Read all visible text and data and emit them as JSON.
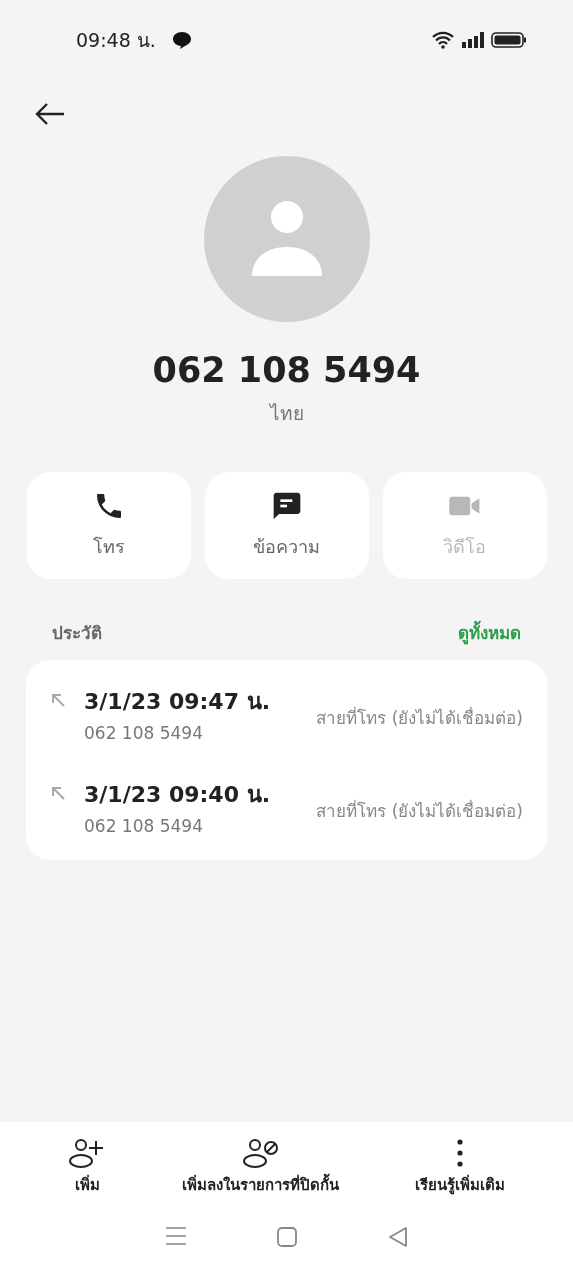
{
  "status_bar": {
    "time": "09:48 น."
  },
  "contact": {
    "number": "062 108 5494",
    "region": "ไทย"
  },
  "actions": [
    {
      "kind": "call",
      "label": "โทร",
      "disabled": false
    },
    {
      "kind": "message",
      "label": "ข้อความ",
      "disabled": false
    },
    {
      "kind": "video",
      "label": "วิดีโอ",
      "disabled": true
    }
  ],
  "history": {
    "title": "ประวัติ",
    "link": "ดูทั้งหมด",
    "calls": [
      {
        "kind": "outgoing",
        "time": "3/1/23 09:47 น.",
        "number": "062 108 5494",
        "status": "สายที่โทร (ยังไม่ได้เชื่อมต่อ)"
      },
      {
        "kind": "outgoing",
        "time": "3/1/23 09:40 น.",
        "number": "062 108 5494",
        "status": "สายที่โทร (ยังไม่ได้เชื่อมต่อ)"
      }
    ]
  },
  "bottom_actions": [
    {
      "kind": "add",
      "label": "เพิ่ม"
    },
    {
      "kind": "block",
      "label": "เพิ่มลงในรายการที่ปิดกั้น"
    },
    {
      "kind": "more",
      "label": "เรียนรู้เพิ่มเติม"
    }
  ]
}
